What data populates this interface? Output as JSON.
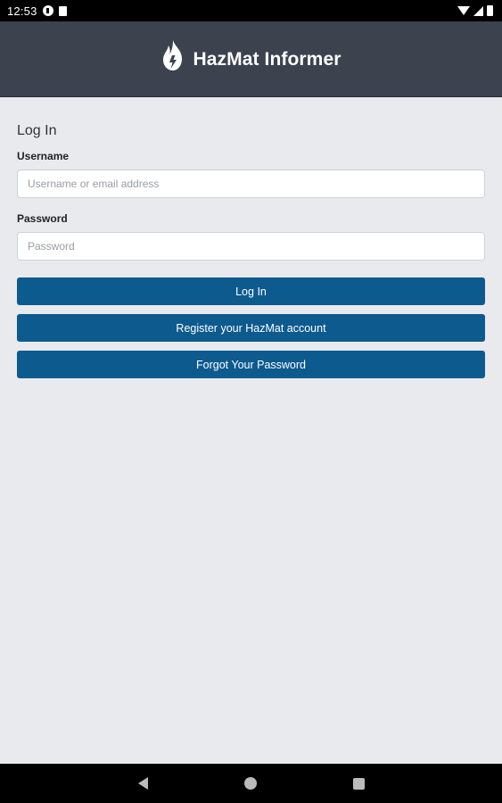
{
  "status_bar": {
    "time": "12:53",
    "left_icons": [
      "notification-icon",
      "sd-card-icon"
    ],
    "right_icons": [
      "wifi-icon",
      "cell-signal-icon",
      "battery-icon"
    ]
  },
  "header": {
    "icon": "flame-icon",
    "title": "HazMat Informer",
    "background": "#3c424e"
  },
  "login_form": {
    "heading": "Log In",
    "username": {
      "label": "Username",
      "placeholder": "Username or email address",
      "value": ""
    },
    "password": {
      "label": "Password",
      "placeholder": "Password",
      "value": ""
    },
    "buttons": {
      "login": "Log In",
      "register": "Register your HazMat account",
      "forgot": "Forgot Your Password"
    },
    "button_color": "#0d5a8f"
  },
  "nav_bar": {
    "icons": [
      "back-icon",
      "home-icon",
      "recents-icon"
    ]
  }
}
